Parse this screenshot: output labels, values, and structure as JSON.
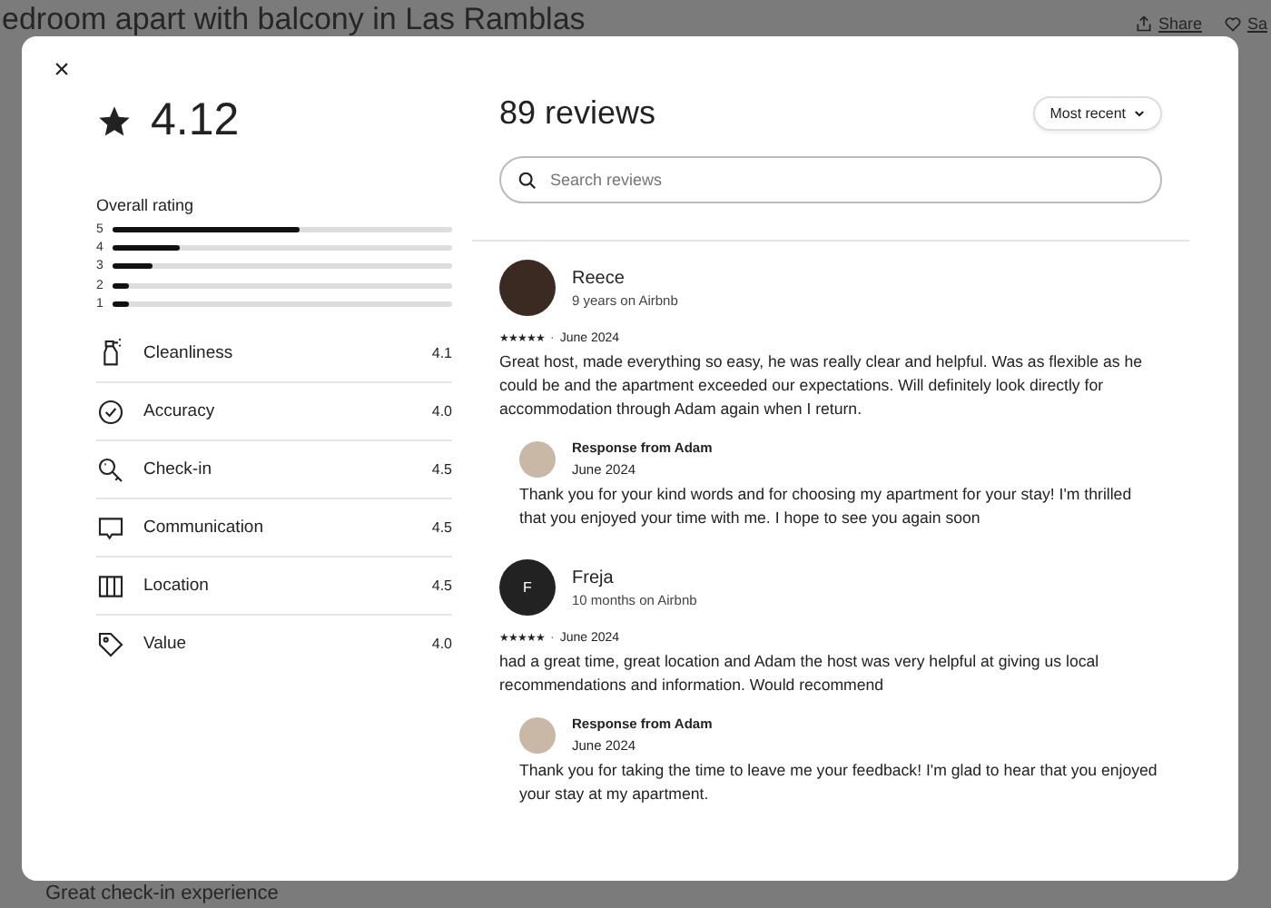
{
  "background": {
    "title": "edroom apart with balcony in Las Ramblas",
    "actions": [
      {
        "label": "Share",
        "kind": "share"
      },
      {
        "label": "Sa",
        "kind": "save"
      }
    ],
    "highlight": "Great check-in experience"
  },
  "modal": {
    "close": "×",
    "rating": "4.12",
    "overall": {
      "title": "Overall rating",
      "bars": [
        {
          "label": "5",
          "level": 0.55
        },
        {
          "label": "4",
          "level": 0.2
        },
        {
          "label": "3",
          "level": 0.12
        },
        {
          "label": "2",
          "level": 0.05
        },
        {
          "label": "1",
          "level": 0.05
        }
      ]
    },
    "categories": [
      {
        "kind": "cleanliness",
        "label": "Cleanliness",
        "value": "4.1"
      },
      {
        "kind": "accuracy",
        "label": "Accuracy",
        "value": "4.0"
      },
      {
        "kind": "checkin",
        "label": "Check-in",
        "value": "4.5"
      },
      {
        "kind": "communication",
        "label": "Communication",
        "value": "4.5"
      },
      {
        "kind": "location",
        "label": "Location",
        "value": "4.5"
      },
      {
        "kind": "value",
        "label": "Value",
        "value": "4.0"
      }
    ],
    "reviews_title": "89 reviews",
    "sort": "Most recent",
    "search": {
      "placeholder": "Search reviews"
    },
    "reviews": [
      {
        "name": "Reece",
        "kind": "photo",
        "tenure": "9 years on Airbnb",
        "stars": 5,
        "separator": "·",
        "date": "June 2024",
        "text": "Great host, made everything so easy, he was really clear and helpful. Was as flexible as he could be and the apartment exceeded our expectations. Will definitely look directly for accommodation through Adam again when I return.",
        "response": {
          "title": "Response from Adam",
          "date": "June 2024",
          "text": "Thank you for your kind words and for choosing my apartment for your stay! I'm thrilled that you enjoyed your time with me. I hope to see you again soon"
        }
      },
      {
        "name": "Freja",
        "kind": "initial",
        "initial": "F",
        "tenure": "10 months on Airbnb",
        "stars": 5,
        "separator": "·",
        "date": "June 2024",
        "text": "had a great time, great location and Adam the host was very helpful at giving us local recommendations and information. Would recommend",
        "response": {
          "title": "Response from Adam",
          "date": "June 2024",
          "text": "Thank you for taking the time to leave me your feedback! I'm glad to hear that you enjoyed your stay at my apartment."
        }
      }
    ]
  }
}
